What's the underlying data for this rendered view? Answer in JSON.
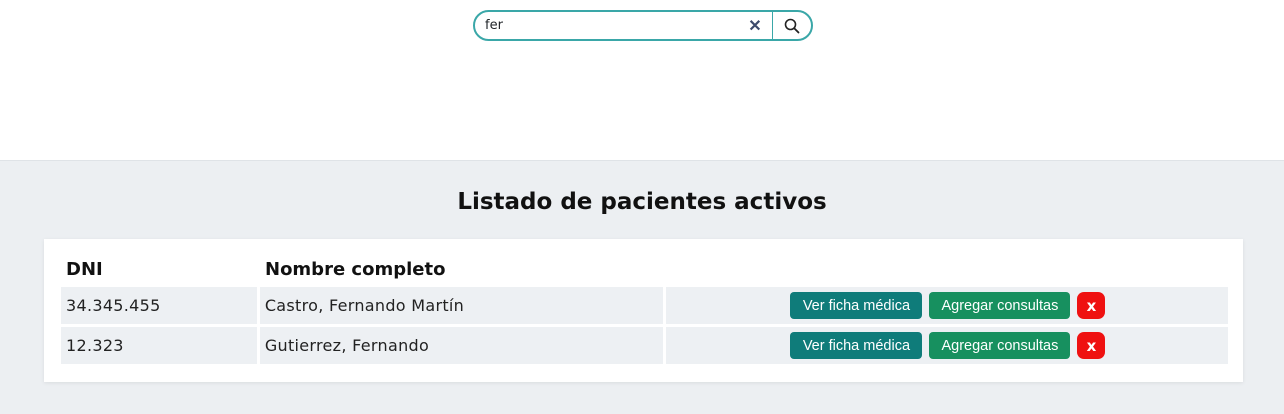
{
  "search": {
    "value": "fer",
    "clear_symbol": "✕"
  },
  "page": {
    "title": "Listado de pacientes activos"
  },
  "table": {
    "headers": [
      "DNI",
      "Nombre completo"
    ],
    "rows": [
      {
        "dni": "34.345.455",
        "nombre": "Castro, Fernando Martín"
      },
      {
        "dni": "12.323",
        "nombre": "Gutierrez, Fernando"
      }
    ],
    "actions": {
      "ficha_label": "Ver ficha médica",
      "consulta_label": "Agregar consultas",
      "delete_label": "x"
    }
  },
  "colors": {
    "search_border": "#3aa7a8",
    "ficha_button": "#0f7c7a",
    "consulta_button": "#17905f",
    "delete_button": "#ef1111",
    "page_background": "#eceff2"
  }
}
